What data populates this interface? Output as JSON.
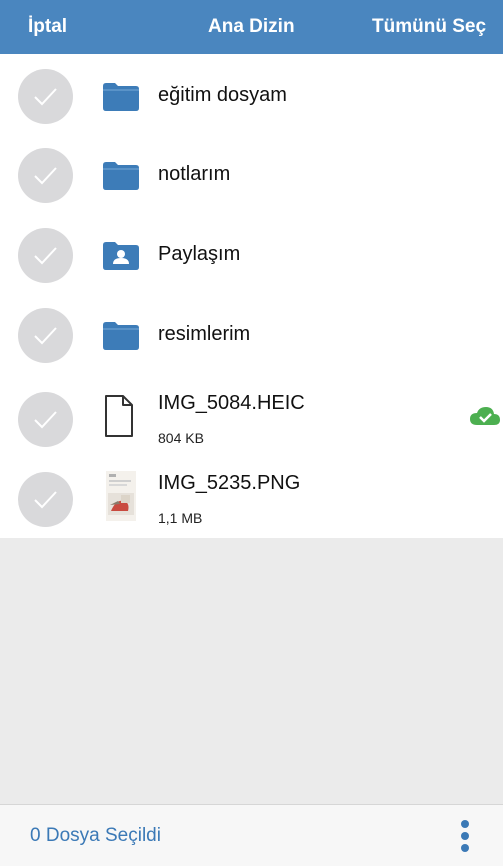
{
  "header": {
    "cancel_label": "İptal",
    "title": "Ana Dizin",
    "select_all_label": "Tümünü Seç"
  },
  "items": [
    {
      "name": "eğitim dosyam",
      "type": "folder"
    },
    {
      "name": "notlarım",
      "type": "folder"
    },
    {
      "name": "Paylaşım",
      "type": "shared-folder"
    },
    {
      "name": "resimlerim",
      "type": "folder"
    },
    {
      "name": "IMG_5084.HEIC",
      "size": "804 KB",
      "type": "file",
      "synced": true
    },
    {
      "name": "IMG_5235.PNG",
      "size": "1,1 MB",
      "type": "image"
    }
  ],
  "footer": {
    "selection_count": "0 Dosya Seçildi"
  },
  "colors": {
    "accent": "#4a86bf",
    "folder": "#3d7cb8",
    "check_bg": "#d9d9db",
    "cloud": "#4caf50"
  }
}
